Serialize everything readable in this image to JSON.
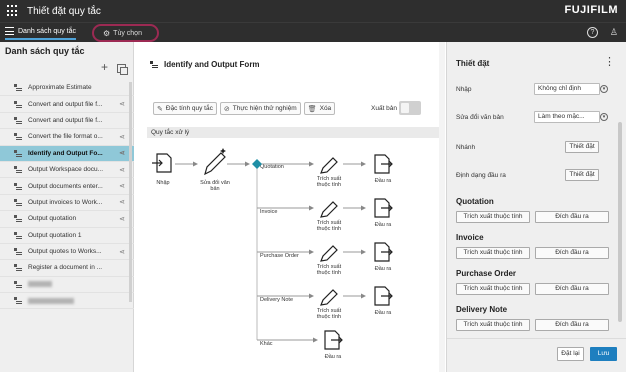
{
  "app": {
    "title": "Thiết đặt quy tắc",
    "brand": "FUJIFILM"
  },
  "tabs": {
    "rules_label": "Danh sách quy tắc",
    "options_label": "Tùy chọn"
  },
  "icons": {
    "help": "help-icon",
    "user": "user-icon",
    "grid": "app-grid-icon"
  },
  "accent": "#4fa3d8",
  "highlight_border": "#9c2a53",
  "left_panel": {
    "title": "Danh sách quy tắc",
    "items": [
      {
        "label": "Approximate Estimate",
        "shared": false,
        "blurred": false,
        "selected": false
      },
      {
        "label": "Convert and output file f...",
        "shared": true,
        "blurred": false,
        "selected": false
      },
      {
        "label": "Convert and output file f...",
        "shared": false,
        "blurred": false,
        "selected": false
      },
      {
        "label": "Convert the file format o...",
        "shared": true,
        "blurred": false,
        "selected": false
      },
      {
        "label": "Identify and Output Fo...",
        "shared": true,
        "blurred": false,
        "selected": true
      },
      {
        "label": "Output Workspace docu...",
        "shared": true,
        "blurred": false,
        "selected": false
      },
      {
        "label": "Output documents enter...",
        "shared": true,
        "blurred": false,
        "selected": false
      },
      {
        "label": "Output invoices to Work...",
        "shared": true,
        "blurred": false,
        "selected": false
      },
      {
        "label": "Output quotation",
        "shared": true,
        "blurred": false,
        "selected": false
      },
      {
        "label": "Output quotation 1",
        "shared": false,
        "blurred": false,
        "selected": false
      },
      {
        "label": "Output quotes to Works...",
        "shared": true,
        "blurred": false,
        "selected": false
      },
      {
        "label": "Register a document in ...",
        "shared": false,
        "blurred": false,
        "selected": false
      },
      {
        "label": "",
        "shared": false,
        "blurred": true,
        "selected": false
      },
      {
        "label": "",
        "shared": false,
        "blurred": true,
        "selected": false
      }
    ]
  },
  "center": {
    "form_title": "Identify and Output Form",
    "toolbar": {
      "edit_label": "Đặc tính quy tắc",
      "test_label": "Thực hiện thử nghiệm",
      "delete_label": "Xóa",
      "export_label": "Xuất bản"
    },
    "export_enabled": false,
    "process_label": "Quy tắc xử lý",
    "flow": {
      "input_label": "Nhập",
      "edit_doc_label": [
        "Sửa đổi văn",
        "bản"
      ],
      "extract_label": [
        "Trích xuất",
        "thuộc tính"
      ],
      "output_label": "Đầu ra",
      "branches": [
        "Quotation",
        "Invoice",
        "Purchase Order",
        "Delivery Note",
        "Khác"
      ]
    }
  },
  "right_panel": {
    "title": "Thiết đặt",
    "input_label": "Nhập",
    "input_value": "Không chỉ định",
    "edit_label": "Sửa đổi văn bản",
    "edit_value": "Làm theo mặc...",
    "branch_label": "Nhánh",
    "branch_button": "Thiết đặt",
    "format_label": "Định dạng đầu ra",
    "format_button": "Thiết đặt",
    "sections": [
      {
        "title": "Quotation",
        "extract": "Trích xuất thuộc tính",
        "output": "Đích đầu ra"
      },
      {
        "title": "Invoice",
        "extract": "Trích xuất thuộc tính",
        "output": "Đích đầu ra"
      },
      {
        "title": "Purchase Order",
        "extract": "Trích xuất thuộc tính",
        "output": "Đích đầu ra"
      },
      {
        "title": "Delivery Note",
        "extract": "Trích xuất thuộc tính",
        "output": "Đích đầu ra"
      }
    ],
    "reset_label": "Đặt lại",
    "save_label": "Lưu"
  }
}
